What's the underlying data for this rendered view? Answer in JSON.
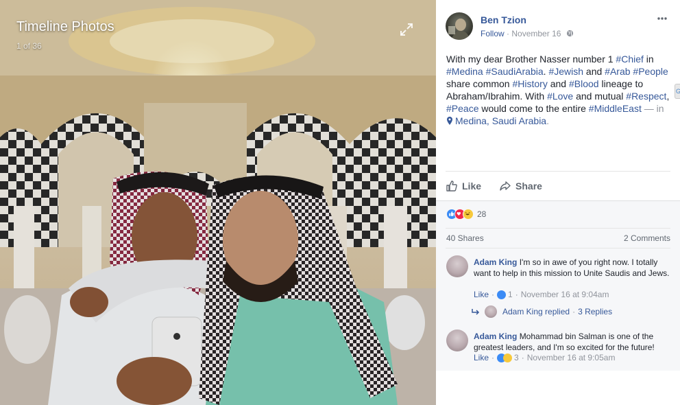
{
  "photo": {
    "title": "Timeline Photos",
    "counter": "1 of 36"
  },
  "post": {
    "author": "Ben Tzion",
    "follow": "Follow",
    "separator": "·",
    "date": "November 16",
    "text": [
      {
        "t": "With my dear Brother Nasser number 1 "
      },
      {
        "t": "#Chief",
        "tag": true
      },
      {
        "t": " in "
      },
      {
        "t": "#Medina",
        "tag": true
      },
      {
        "t": " "
      },
      {
        "t": "#SaudiArabia",
        "tag": true
      },
      {
        "t": ". "
      },
      {
        "t": "#Jewish",
        "tag": true
      },
      {
        "t": " and "
      },
      {
        "t": "#Arab",
        "tag": true
      },
      {
        "t": " "
      },
      {
        "t": "#People",
        "tag": true
      },
      {
        "t": " share common "
      },
      {
        "t": "#History",
        "tag": true
      },
      {
        "t": " and "
      },
      {
        "t": "#Blood",
        "tag": true
      },
      {
        "t": " lineage to Abraham/Ibrahim. With "
      },
      {
        "t": "#Love",
        "tag": true
      },
      {
        "t": " and mutual "
      },
      {
        "t": "#Respect",
        "tag": true
      },
      {
        "t": ", "
      },
      {
        "t": "#Peace",
        "tag": true
      },
      {
        "t": " would come to the entire "
      },
      {
        "t": "#MiddleEast",
        "tag": true
      }
    ],
    "location_prefix": " — in ",
    "location": "Medina, Saudi Arabia",
    "location_suffix": "."
  },
  "actions": {
    "like": "Like",
    "share": "Share"
  },
  "reactions": {
    "count": "28",
    "types": [
      "like",
      "love",
      "haha"
    ]
  },
  "stats": {
    "shares": "40 Shares",
    "comments": "2 Comments"
  },
  "comments": [
    {
      "author": "Adam King",
      "text": "I'm so in awe of you right now. I totally want to help in this mission to Unite Saudis and Jews.",
      "like_label": "Like",
      "reaction_count": "1",
      "time": "November 16 at 9:04am",
      "replies_text": "Adam King replied",
      "replies_sep": "·",
      "replies_count": "3 Replies"
    },
    {
      "author": "Adam King",
      "text": "Mohammad bin Salman is one of the greatest leaders, and I'm so excited for the future!",
      "like_label": "Like",
      "reaction_count": "3",
      "time": "November 16 at 9:05am"
    }
  ],
  "side_tab": "G",
  "colors": {
    "link": "#365899",
    "muted": "#90949c",
    "like_blue": "#3b8bf5",
    "love_red": "#f0284a",
    "haha_yellow": "#f7c93b"
  }
}
